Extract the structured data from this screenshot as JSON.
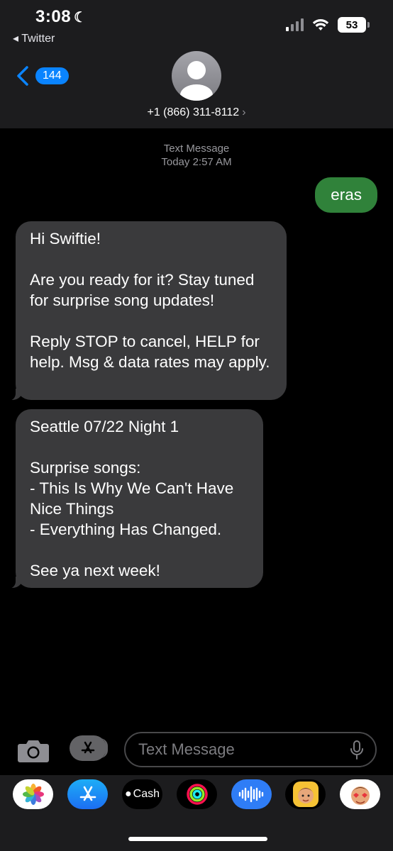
{
  "status_bar": {
    "time": "3:08",
    "back_app": "◂ Twitter",
    "battery": "53"
  },
  "header": {
    "back_count": "144",
    "contact": "+1 (866) 311-8112",
    "chevron": "›"
  },
  "conversation": {
    "timestamp_label": "Text Message",
    "timestamp_time": "Today 2:57 AM",
    "messages": [
      {
        "direction": "outgoing",
        "text": "eras"
      },
      {
        "direction": "incoming",
        "text": "Hi Swiftie!\n\nAre you ready for it? Stay tuned for surprise song updates!\n\nReply STOP to cancel, HELP for help. Msg & data rates may apply."
      },
      {
        "direction": "incoming",
        "text": "Seattle 07/22 Night 1\n\nSurprise songs:\n- This Is Why We Can't Have Nice Things\n- Everything Has Changed.\n\nSee ya next week!"
      }
    ]
  },
  "composer": {
    "placeholder": "Text Message"
  },
  "app_tray": {
    "apps": [
      "photos-icon",
      "app-store-icon",
      "apple-cash-icon",
      "activity-icon",
      "audio-message-icon",
      "memoji-icon",
      "memoji-stickers-icon"
    ],
    "cash_label": "Cash"
  },
  "colors": {
    "outgoing_bubble": "#30823a",
    "incoming_bubble": "#3a3a3c",
    "accent": "#0a84ff",
    "header_bg": "#1c1c1e"
  }
}
